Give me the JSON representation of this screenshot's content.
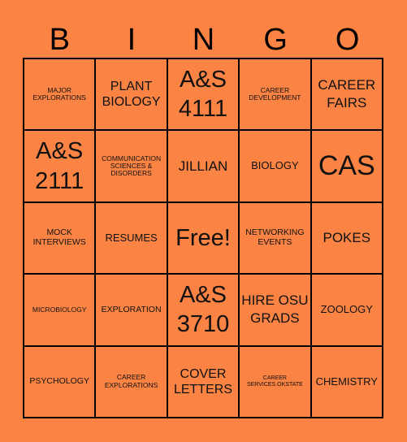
{
  "title_letters": [
    "B",
    "I",
    "N",
    "G",
    "O"
  ],
  "background_color": "#fb8444",
  "border_color": "#000000",
  "cells": [
    [
      "MAJOR EXPLORATIONS",
      "PLANT BIOLOGY",
      "A&S 4111",
      "CAREER DEVELOPMENT",
      "CAREER FAIRS"
    ],
    [
      "A&S 2111",
      "COMMUNICATION SCIENCES & DISORDERS",
      "JILLIAN",
      "BIOLOGY",
      "CAS"
    ],
    [
      "MOCK INTERVIEWS",
      "RESUMES",
      "Free!",
      "NETWORKING EVENTS",
      "POKES"
    ],
    [
      "MICROBIOLOGY",
      "EXPLORATION",
      "A&S 3710",
      "HIRE OSU GRADS",
      "ZOOLOGY"
    ],
    [
      "PSYCHOLOGY",
      "CAREER EXPLORATIONS",
      "COVER LETTERS",
      "CAREER SERVICES.OKSTATE",
      "CHEMISTRY"
    ]
  ],
  "free_space": {
    "row": 2,
    "col": 2,
    "label": "Free!"
  }
}
